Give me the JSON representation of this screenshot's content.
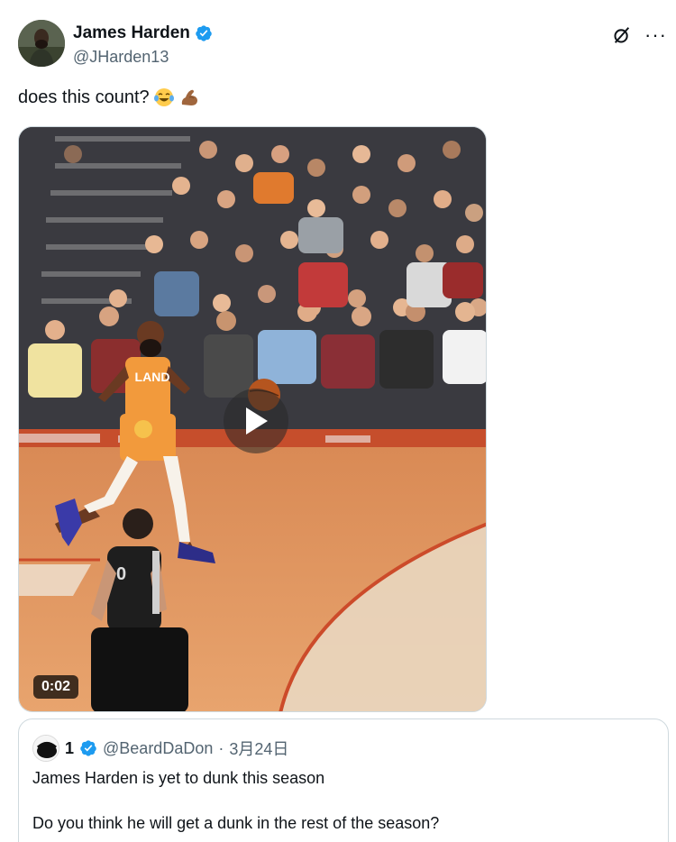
{
  "author": {
    "display_name": "James Harden",
    "handle": "@JHarden13",
    "verified": true,
    "avatar_icon": "avatar-photo"
  },
  "actions": {
    "grok_icon": "grok-icon",
    "more_icon": "more-icon",
    "more_label": "···"
  },
  "tweet": {
    "text": "does this count?",
    "emojis": [
      "tears-of-joy-emoji",
      "flexed-biceps-emoji"
    ]
  },
  "media": {
    "type": "video",
    "duration": "0:02",
    "play_icon": "play-icon",
    "jersey_text": "LAND"
  },
  "quoted_tweet": {
    "display_name": "1",
    "handle": "@BeardDaDon",
    "separator": "·",
    "date": "3月24日",
    "verified": true,
    "line1": "James Harden is yet to dunk this season",
    "line2": "Do you think he will get a dunk in the rest of the season?"
  },
  "colors": {
    "verified_blue": "#1d9bf0",
    "text_primary": "#0f1419",
    "text_secondary": "#536471",
    "border": "#cfd9de"
  }
}
